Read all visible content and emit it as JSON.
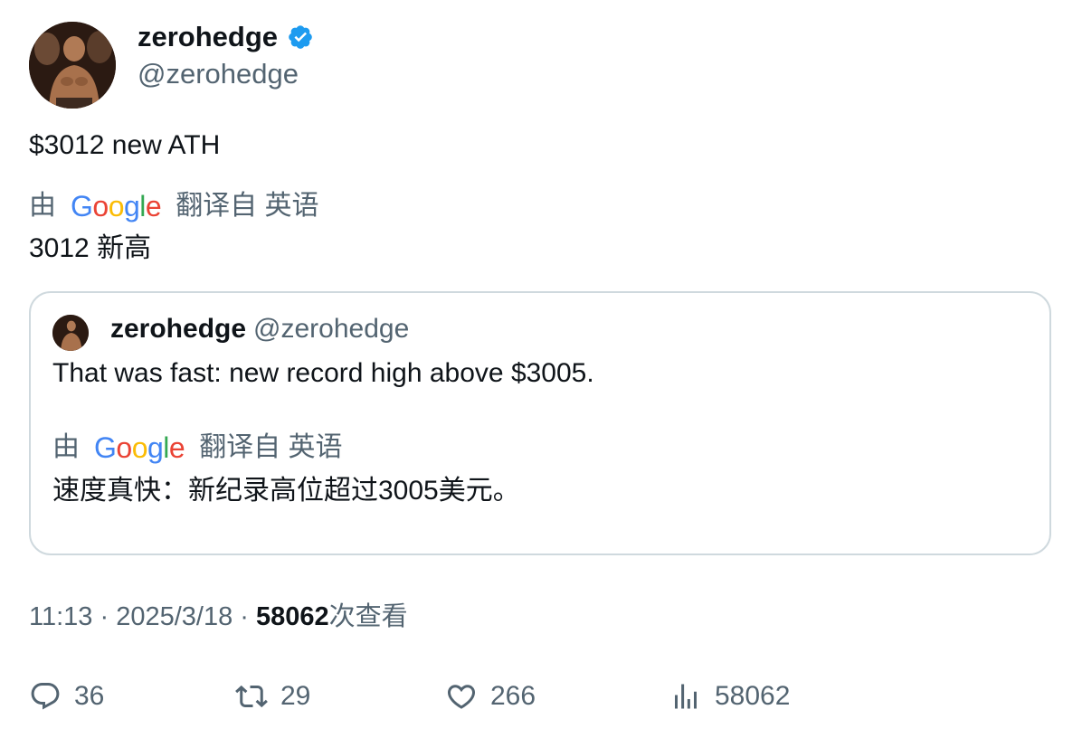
{
  "author": {
    "display_name": "zerohedge",
    "handle": "@zerohedge",
    "verified": true,
    "verified_color": "#1d9bf0"
  },
  "tweet": {
    "text": "$3012 new ATH",
    "translation": {
      "by_label": "由",
      "provider": "Google",
      "from_label": "翻译自 英语",
      "text": "3012 新高"
    }
  },
  "quote": {
    "display_name": "zerohedge",
    "handle": "@zerohedge",
    "text": "That was fast: new record high above $3005.",
    "translation": {
      "by_label": "由",
      "provider": "Google",
      "from_label": "翻译自 英语",
      "text": "速度真快：新纪录高位超过3005美元。"
    }
  },
  "meta": {
    "time": "11:13",
    "separator1": " · ",
    "date": "2025/3/18",
    "separator2": " · ",
    "views_count": "58062",
    "views_label": "次查看"
  },
  "actions": {
    "replies": "36",
    "retweets": "29",
    "likes": "266",
    "views": "58062"
  },
  "icons": {
    "reply": "reply-icon",
    "retweet": "retweet-icon",
    "like": "heart-icon",
    "views": "bar-chart-icon",
    "verified": "verified-badge-icon"
  }
}
